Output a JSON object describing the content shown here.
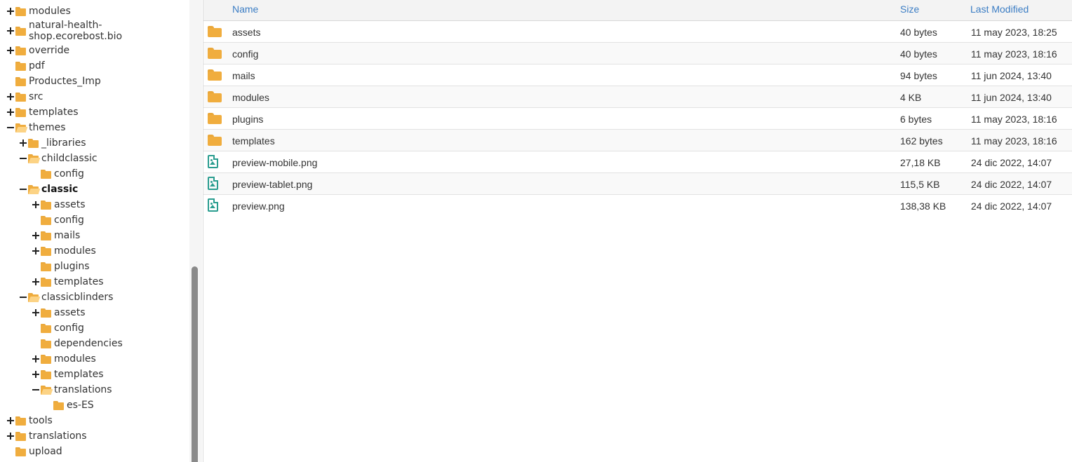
{
  "tree": [
    {
      "label": "modules",
      "toggle": "plus",
      "icon": "closed"
    },
    {
      "label": "natural-health-shop.ecorebost.bio",
      "toggle": "plus",
      "icon": "closed"
    },
    {
      "label": "override",
      "toggle": "plus",
      "icon": "closed"
    },
    {
      "label": "pdf",
      "toggle": "none",
      "icon": "closed"
    },
    {
      "label": "Productes_Imp",
      "toggle": "none",
      "icon": "closed"
    },
    {
      "label": "src",
      "toggle": "plus",
      "icon": "closed"
    },
    {
      "label": "templates",
      "toggle": "plus",
      "icon": "closed"
    },
    {
      "label": "themes",
      "toggle": "minus",
      "icon": "open"
    },
    {
      "label": "_libraries",
      "toggle": "plus",
      "icon": "closed"
    },
    {
      "label": "childclassic",
      "toggle": "minus",
      "icon": "open"
    },
    {
      "label": "config",
      "toggle": "none",
      "icon": "closed"
    },
    {
      "label": "classic",
      "toggle": "minus",
      "icon": "open",
      "selected": true
    },
    {
      "label": "assets",
      "toggle": "plus",
      "icon": "closed"
    },
    {
      "label": "config",
      "toggle": "none",
      "icon": "closed"
    },
    {
      "label": "mails",
      "toggle": "plus",
      "icon": "closed"
    },
    {
      "label": "modules",
      "toggle": "plus",
      "icon": "closed"
    },
    {
      "label": "plugins",
      "toggle": "none",
      "icon": "closed"
    },
    {
      "label": "templates",
      "toggle": "plus",
      "icon": "closed"
    },
    {
      "label": "classicblinders",
      "toggle": "minus",
      "icon": "open"
    },
    {
      "label": "assets",
      "toggle": "plus",
      "icon": "closed"
    },
    {
      "label": "config",
      "toggle": "none",
      "icon": "closed"
    },
    {
      "label": "dependencies",
      "toggle": "none",
      "icon": "closed"
    },
    {
      "label": "modules",
      "toggle": "plus",
      "icon": "closed"
    },
    {
      "label": "templates",
      "toggle": "plus",
      "icon": "closed"
    },
    {
      "label": "translations",
      "toggle": "minus",
      "icon": "open"
    },
    {
      "label": "es-ES",
      "toggle": "none",
      "icon": "closed"
    },
    {
      "label": "tools",
      "toggle": "plus",
      "icon": "closed"
    },
    {
      "label": "translations",
      "toggle": "plus",
      "icon": "closed"
    },
    {
      "label": "upload",
      "toggle": "none",
      "icon": "closed"
    }
  ],
  "table": {
    "headers": {
      "name": "Name",
      "size": "Size",
      "modified": "Last Modified"
    },
    "rows": [
      {
        "name": "assets",
        "size": "40 bytes",
        "modified": "11 may 2023, 18:25",
        "type": "folder-icon"
      },
      {
        "name": "config",
        "size": "40 bytes",
        "modified": "11 may 2023, 18:16",
        "type": "folder-icon"
      },
      {
        "name": "mails",
        "size": "94 bytes",
        "modified": "11 jun 2024, 13:40",
        "type": "folder-icon"
      },
      {
        "name": "modules",
        "size": "4 KB",
        "modified": "11 jun 2024, 13:40",
        "type": "folder-icon"
      },
      {
        "name": "plugins",
        "size": "6 bytes",
        "modified": "11 may 2023, 18:16",
        "type": "folder-icon"
      },
      {
        "name": "templates",
        "size": "162 bytes",
        "modified": "11 may 2023, 18:16",
        "type": "folder-icon"
      },
      {
        "name": "preview-mobile.png",
        "size": "27,18 KB",
        "modified": "24 dic 2022, 14:07",
        "type": "image-file-icon"
      },
      {
        "name": "preview-tablet.png",
        "size": "115,5 KB",
        "modified": "24 dic 2022, 14:07",
        "type": "image-file-icon"
      },
      {
        "name": "preview.png",
        "size": "138,38 KB",
        "modified": "24 dic 2022, 14:07",
        "type": "image-file-icon"
      }
    ]
  },
  "colors": {
    "accent": "#3b7dc4",
    "folder": "#f0ad3e",
    "image_icon": "#2a9d8f"
  }
}
